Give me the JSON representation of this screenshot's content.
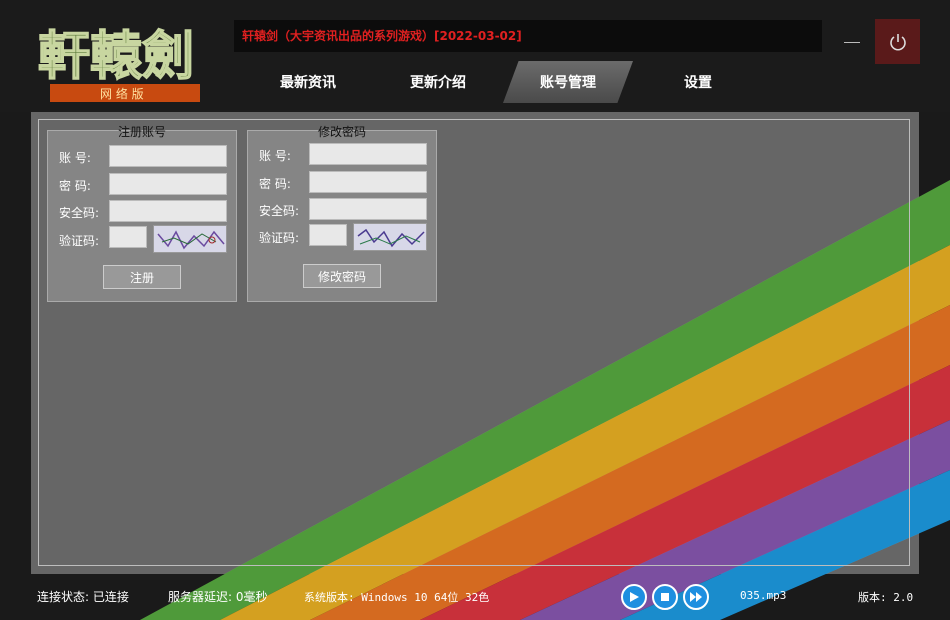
{
  "window": {
    "title": "轩辕剑（大宇资讯出品的系列游戏）[2022-03-02]",
    "logo_text": "軒轅劍",
    "logo_subtitle": "网 络 版"
  },
  "tabs": [
    {
      "label": "最新资讯",
      "active": false
    },
    {
      "label": "更新介绍",
      "active": false
    },
    {
      "label": "账号管理",
      "active": true
    },
    {
      "label": "设置",
      "active": false
    }
  ],
  "register": {
    "title": "注册账号",
    "account_label": "账  号:",
    "password_label": "密  码:",
    "security_label": "安全码:",
    "code_label": "验证码:",
    "button": "注册"
  },
  "change_password": {
    "title": "修改密码",
    "account_label": "账  号:",
    "password_label": "密  码:",
    "security_label": "安全码:",
    "code_label": "验证码:",
    "button": "修改密码"
  },
  "status": {
    "connection": "连接状态: 已连接",
    "latency": "服务器延迟: 0毫秒",
    "system": "系统版本: Windows 10 64位 32色",
    "track": "035.mp3",
    "version": "版本: 2.0"
  },
  "colors": {
    "accent_red": "#e02020",
    "media_blue": "#1e8fe0",
    "panel_gray": "#666666"
  }
}
